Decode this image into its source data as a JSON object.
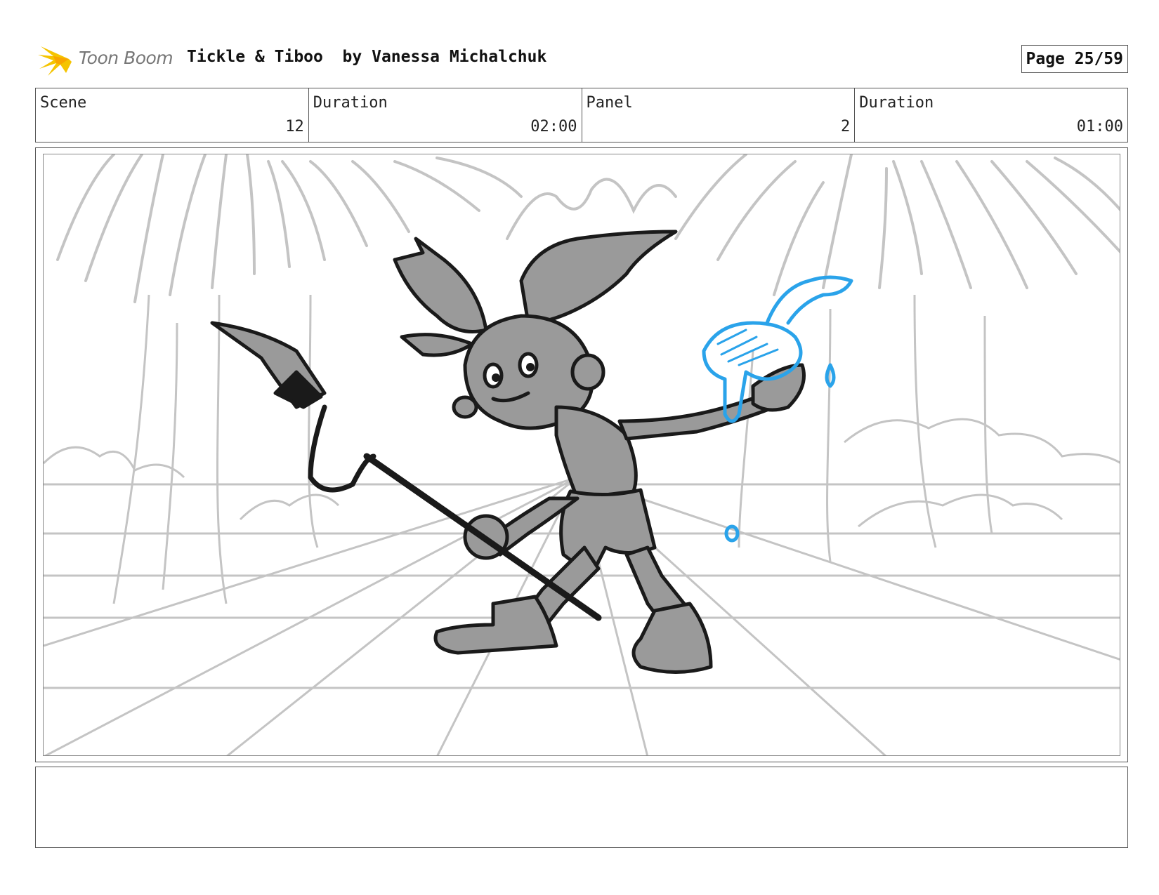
{
  "header": {
    "logo_text": "Toon Boom",
    "title": "Tickle & Tiboo  by Vanessa Michalchuk",
    "page_label": "Page 25/59"
  },
  "info": {
    "scene_label": "Scene",
    "scene_value": "12",
    "scene_duration_label": "Duration",
    "scene_duration_value": "02:00",
    "panel_label": "Panel",
    "panel_value": "2",
    "panel_duration_label": "Duration",
    "panel_duration_value": "01:00"
  },
  "notes": {
    "text": ""
  },
  "colors": {
    "sketch_gray": "#bdbdbd",
    "character_fill": "#9a9a9a",
    "line_dark": "#1a1a1a",
    "accent_blue": "#2aa3ea",
    "logo_yellow": "#f5c400"
  },
  "icons": {
    "logo": "toon-boom-starburst-icon"
  }
}
